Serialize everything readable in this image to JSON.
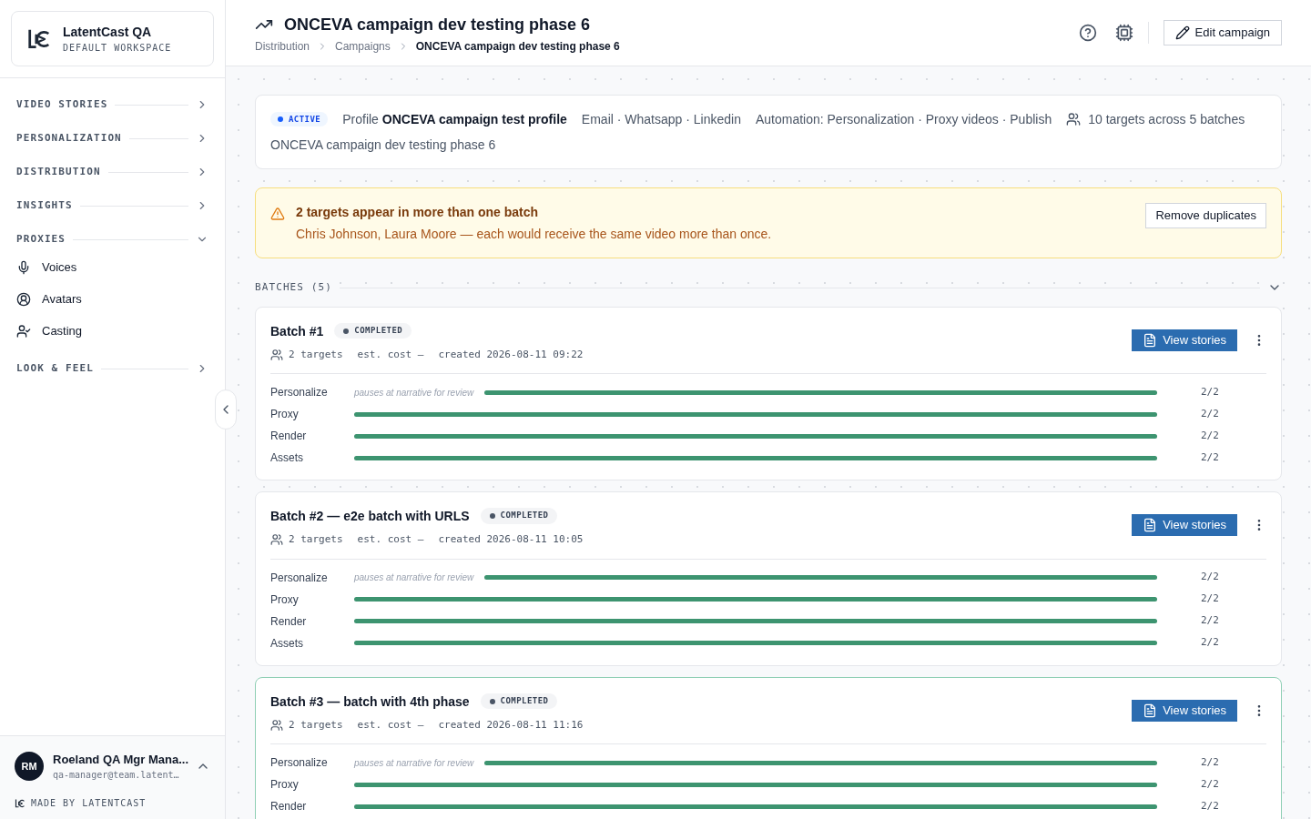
{
  "workspace": {
    "name": "LatentCast QA",
    "subtitle": "DEFAULT WORKSPACE"
  },
  "sidebar": {
    "sections": [
      {
        "label": "VIDEO STORIES",
        "expanded": false
      },
      {
        "label": "PERSONALIZATION",
        "expanded": false
      },
      {
        "label": "DISTRIBUTION",
        "expanded": false
      },
      {
        "label": "INSIGHTS",
        "expanded": false
      },
      {
        "label": "PROXIES",
        "expanded": true,
        "items": [
          {
            "label": "Voices",
            "kind": "mic"
          },
          {
            "label": "Avatars",
            "kind": "avatar"
          },
          {
            "label": "Casting",
            "kind": "casting"
          }
        ]
      },
      {
        "label": "LOOK & FEEL",
        "expanded": false
      }
    ]
  },
  "user": {
    "initials": "RM",
    "name": "Roeland QA Mgr Mana...",
    "email": "qa-manager@team.latent…",
    "footer": "MADE BY LATENTCAST"
  },
  "header": {
    "title": "ONCEVA campaign dev testing phase 6",
    "breadcrumbs": [
      "Distribution",
      "Campaigns",
      "ONCEVA campaign dev testing phase 6"
    ],
    "edit_button": "Edit campaign"
  },
  "summary": {
    "status": "ACTIVE",
    "profile_label": "Profile",
    "profile": "ONCEVA campaign test profile",
    "channels": "Email · Whatsapp · Linkedin",
    "automation": "Automation: Personalization · Proxy videos · Publish",
    "targets": "10 targets across 5 batches",
    "description": "ONCEVA campaign dev testing phase 6"
  },
  "warning": {
    "title": "2 targets appear in more than one batch",
    "message": "Chris Johnson, Laura Moore — each would receive the same video more than once.",
    "button": "Remove duplicates"
  },
  "batches_heading": "BATCHES (5)",
  "batches": [
    {
      "title": "Batch #1",
      "status": "COMPLETED",
      "highlighted": false,
      "targets": "2 targets",
      "cost": "est. cost —",
      "created": "created 2026-08-11 09:22",
      "button": "View stories",
      "stages": [
        {
          "name": "Personalize",
          "note": "pauses at narrative for review",
          "level": 1,
          "count": "2/2"
        },
        {
          "name": "Proxy",
          "level": 1,
          "count": "2/2"
        },
        {
          "name": "Render",
          "level": 1,
          "count": "2/2"
        },
        {
          "name": "Assets",
          "level": 1,
          "count": "2/2"
        }
      ]
    },
    {
      "title": "Batch #2 — e2e batch with URLS",
      "status": "COMPLETED",
      "highlighted": false,
      "targets": "2 targets",
      "cost": "est. cost —",
      "created": "created 2026-08-11 10:05",
      "button": "View stories",
      "stages": [
        {
          "name": "Personalize",
          "note": "pauses at narrative for review",
          "level": 1,
          "count": "2/2"
        },
        {
          "name": "Proxy",
          "level": 1,
          "count": "2/2"
        },
        {
          "name": "Render",
          "level": 1,
          "count": "2/2"
        },
        {
          "name": "Assets",
          "level": 1,
          "count": "2/2"
        }
      ]
    },
    {
      "title": "Batch #3 — batch with 4th phase",
      "status": "COMPLETED",
      "highlighted": true,
      "targets": "2 targets",
      "cost": "est. cost —",
      "created": "created 2026-08-11 11:16",
      "button": "View stories",
      "stages": [
        {
          "name": "Personalize",
          "note": "pauses at narrative for review",
          "level": 1,
          "count": "2/2"
        },
        {
          "name": "Proxy",
          "level": 1,
          "count": "2/2"
        },
        {
          "name": "Render",
          "level": 1,
          "count": "2/2"
        }
      ]
    }
  ]
}
